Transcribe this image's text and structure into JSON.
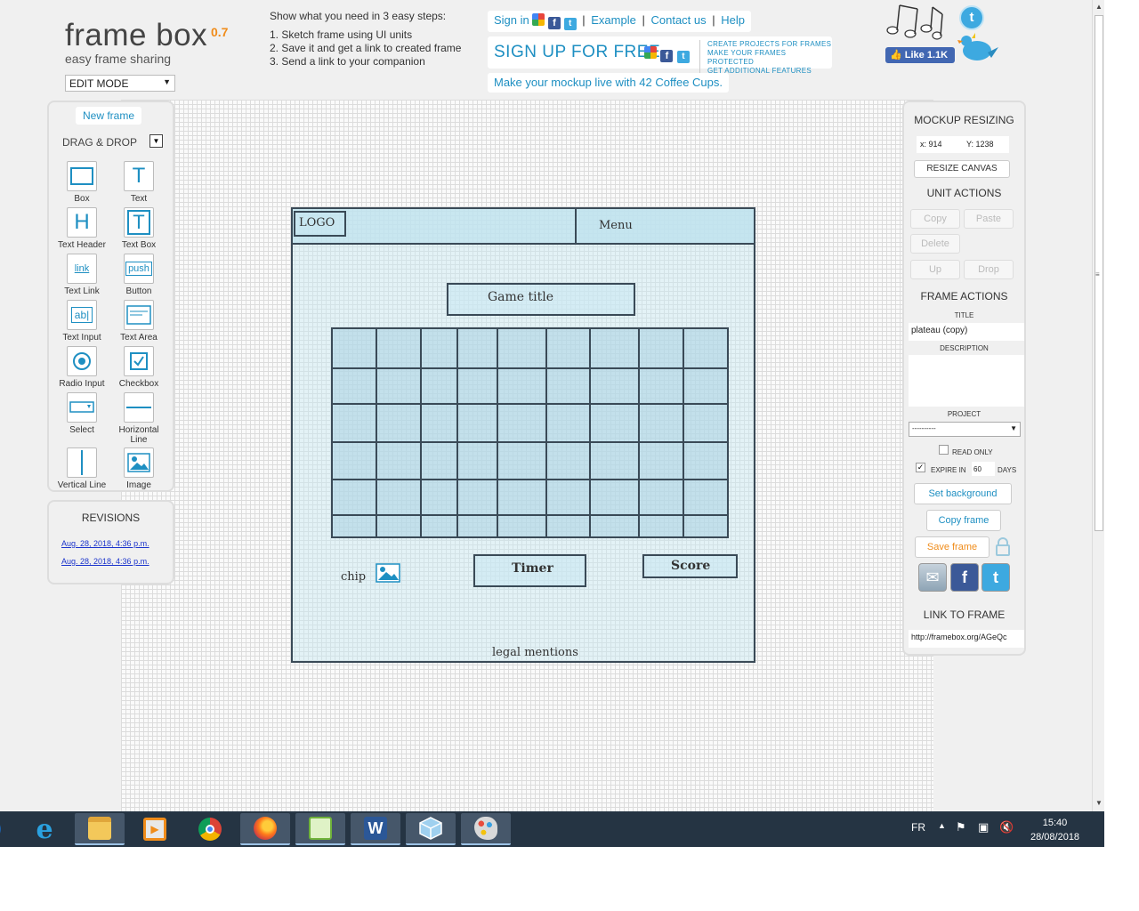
{
  "header": {
    "app_title": "frame box",
    "version": "0.7",
    "tagline": "easy frame sharing",
    "mode": "EDIT MODE",
    "steps_head": "Show what you need in 3 easy steps:",
    "steps": [
      "1.  Sketch frame using UI units",
      "2.  Save it and get a link to created frame",
      "3.  Send a link to your companion"
    ],
    "sign_in": "Sign in",
    "example": "Example",
    "contact": "Contact us",
    "help": "Help",
    "signup": "SIGN UP FOR FREE",
    "signup_benefits": [
      "CREATE PROJECTS FOR FRAMES",
      "MAKE YOUR FRAMES PROTECTED",
      "GET ADDITIONAL FEATURES"
    ],
    "promo": "Make your mockup live with 42 Coffee Cups.",
    "fb_like": "Like 1.1K"
  },
  "tools": {
    "new_frame": "New frame",
    "drag_drop": "DRAG & DROP",
    "items": [
      {
        "label": "Box",
        "icon": "box-icon"
      },
      {
        "label": "Text",
        "icon": "text-icon"
      },
      {
        "label": "Text Header",
        "icon": "text-header-icon"
      },
      {
        "label": "Text Box",
        "icon": "text-box-icon"
      },
      {
        "label": "Text Link",
        "icon": "text-link-icon"
      },
      {
        "label": "Button",
        "icon": "button-icon"
      },
      {
        "label": "Text Input",
        "icon": "text-input-icon"
      },
      {
        "label": "Text Area",
        "icon": "text-area-icon"
      },
      {
        "label": "Radio Input",
        "icon": "radio-icon"
      },
      {
        "label": "Checkbox",
        "icon": "checkbox-icon"
      },
      {
        "label": "Select",
        "icon": "select-icon"
      },
      {
        "label": "Horizontal Line",
        "icon": "hline-icon"
      },
      {
        "label": "Vertical Line",
        "icon": "vline-icon"
      },
      {
        "label": "Image",
        "icon": "image-icon"
      }
    ],
    "icon_glyphs": {
      "t": "T",
      "h": "H",
      "link": "link",
      "push": "push",
      "ab": "ab|"
    }
  },
  "revisions": {
    "title": "REVISIONS",
    "items": [
      "Aug. 28, 2018, 4:36 p.m.",
      "Aug. 28, 2018, 4:36 p.m."
    ]
  },
  "mockup": {
    "logo": "LOGO",
    "menu": "Menu",
    "game_title": "Game title",
    "chip": "chip",
    "timer": "Timer",
    "score": "Score",
    "legal": "legal mentions"
  },
  "right_panel": {
    "mockup_resizing": "MOCKUP RESIZING",
    "x_label": "x:",
    "x_value": "914",
    "y_label": "Y:",
    "y_value": "1238",
    "resize_canvas": "RESIZE CANVAS",
    "unit_actions": "UNIT ACTIONS",
    "copy": "Copy",
    "paste": "Paste",
    "delete": "Delete",
    "up": "Up",
    "drop": "Drop",
    "frame_actions": "FRAME ACTIONS",
    "title_label": "TITLE",
    "title_value": "plateau (copy)",
    "description_label": "DESCRIPTION",
    "project_label": "PROJECT",
    "project_value": "----------",
    "read_only": "READ ONLY",
    "expire_in": "EXPIRE IN",
    "expire_days": "60",
    "days": "DAYS",
    "set_background": "Set background",
    "copy_frame": "Copy frame",
    "save_frame": "Save frame",
    "link_to_frame": "LINK TO FRAME",
    "link_value": "http://framebox.org/AGeQc"
  },
  "taskbar": {
    "lang": "FR",
    "time": "15:40",
    "date": "28/08/2018"
  },
  "colors": {
    "accent": "#1e8fc2",
    "orange": "#f08c1a",
    "mock_border": "#3a4a57",
    "taskbar": "#253443"
  }
}
